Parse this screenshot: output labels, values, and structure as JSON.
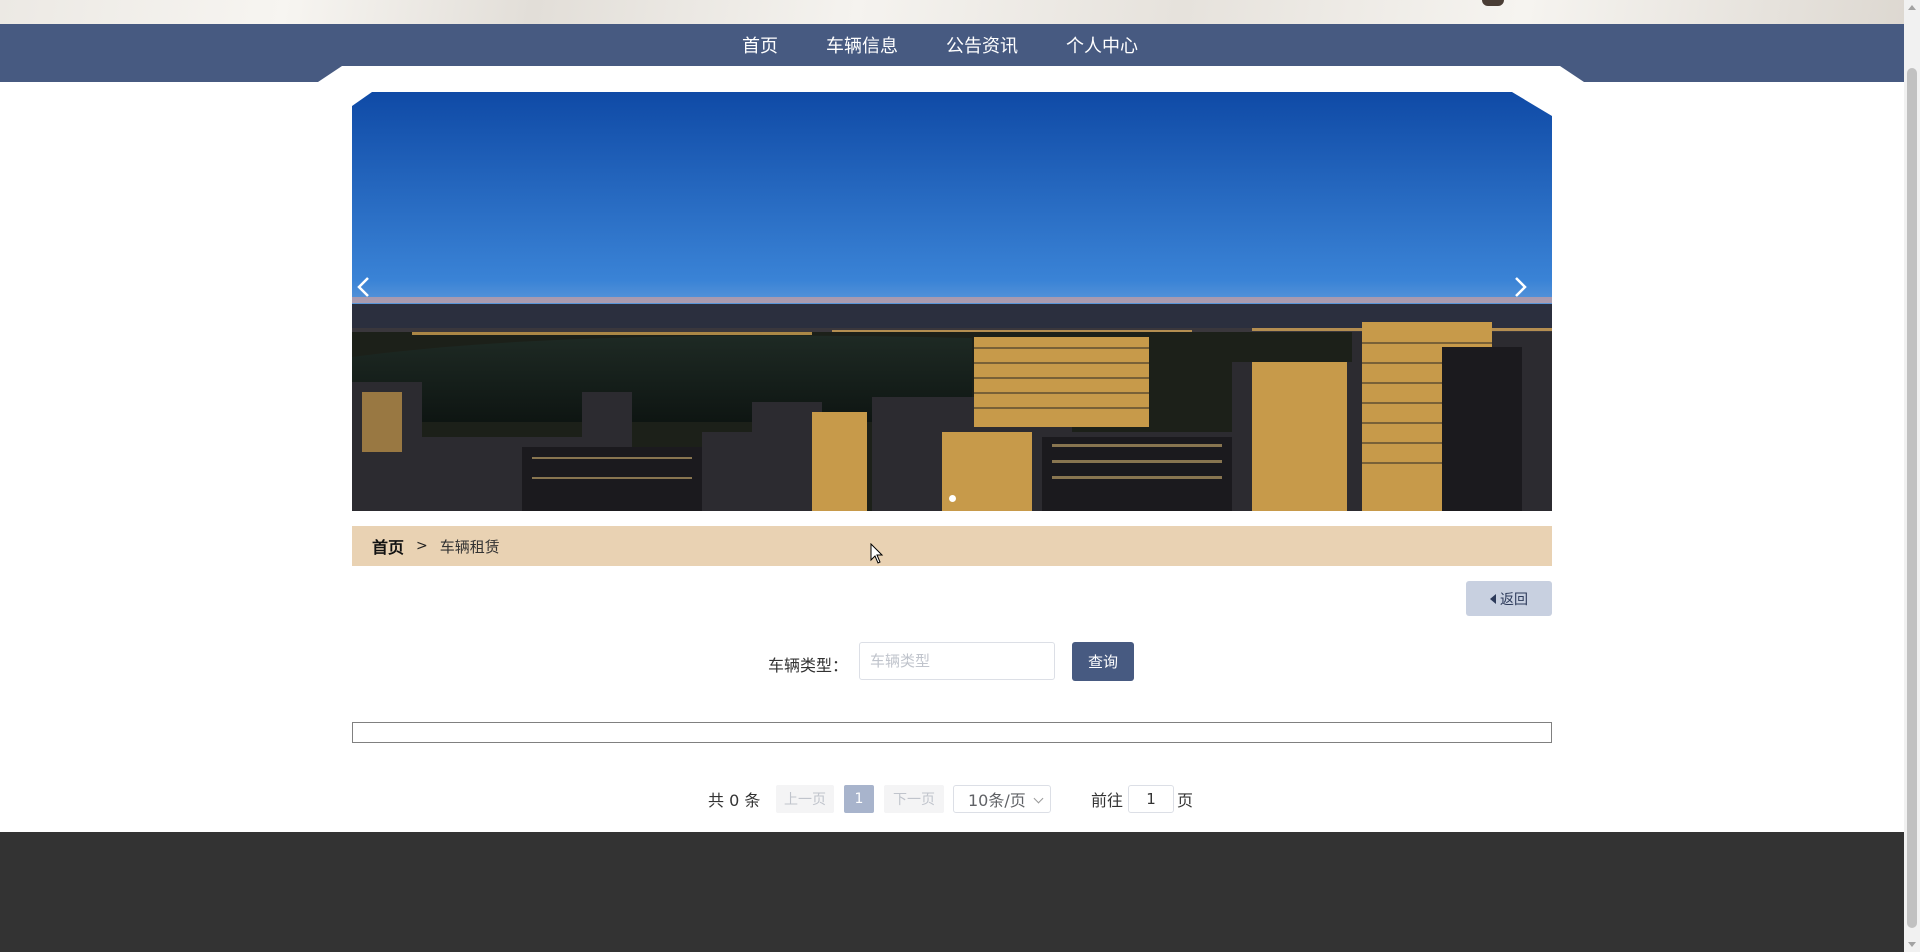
{
  "nav": {
    "items": [
      {
        "label": "首页"
      },
      {
        "label": "车辆信息"
      },
      {
        "label": "公告资讯"
      },
      {
        "label": "个人中心"
      }
    ]
  },
  "banner": {
    "image": "city-night-skyline",
    "prev_icon": "chevron-left-icon",
    "next_icon": "chevron-right-icon",
    "active_slide": 1,
    "slide_count": 1
  },
  "breadcrumb": {
    "home": "首页",
    "separator": ">",
    "current": "车辆租赁"
  },
  "back_button": {
    "label": "返回",
    "icon": "caret-left-icon"
  },
  "search": {
    "label": "车辆类型：",
    "placeholder": "车辆类型",
    "value": "",
    "button_label": "查询"
  },
  "table": {
    "rows": []
  },
  "pagination": {
    "total_text": "共 0 条",
    "prev_label": "上一页",
    "current_page": "1",
    "next_label": "下一页",
    "page_size": "10条/页",
    "goto_label": "前往",
    "goto_value": "1",
    "goto_unit": "页"
  },
  "colors": {
    "nav_bg": "#475a81",
    "breadcrumb_bg": "#e9d2b3",
    "search_button": "#475a81",
    "footer_bg": "#333333"
  }
}
